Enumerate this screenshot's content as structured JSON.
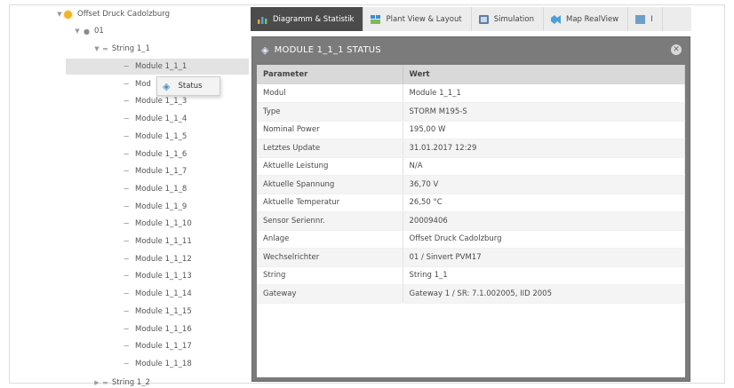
{
  "tree": {
    "root": "Offset Druck Cadolzburg",
    "level1": "01",
    "string_open": "String 1_1",
    "modules": [
      "Module 1_1_1",
      "Mod",
      "Module 1_1_3",
      "Module 1_1_4",
      "Module 1_1_5",
      "Module 1_1_6",
      "Module 1_1_7",
      "Module 1_1_8",
      "Module 1_1_9",
      "Module 1_1_10",
      "Module 1_1_11",
      "Module 1_1_12",
      "Module 1_1_13",
      "Module 1_1_14",
      "Module 1_1_15",
      "Module 1_1_16",
      "Module 1_1_17",
      "Module 1_1_18"
    ],
    "string_closed": "String 1_2"
  },
  "context_menu": {
    "label": "Status"
  },
  "tabs": [
    {
      "label": "Diagramm & Statistik",
      "icon": "bar-chart-icon",
      "active": true
    },
    {
      "label": "Plant View & Layout",
      "icon": "plant-layout-icon",
      "active": false
    },
    {
      "label": "Simulation",
      "icon": "simulation-icon",
      "active": false
    },
    {
      "label": "Map RealView",
      "icon": "map-icon",
      "active": false
    },
    {
      "label": "I",
      "icon": "more-icon",
      "active": false
    }
  ],
  "dialog": {
    "title": "MODULE 1_1_1 STATUS",
    "close_icon": "close-icon",
    "columns": [
      "Parameter",
      "Wert"
    ],
    "rows": [
      [
        "Modul",
        "Module 1_1_1"
      ],
      [
        "Type",
        "STORM M195-S"
      ],
      [
        "Nominal Power",
        "195,00 W"
      ],
      [
        "Letztes Update",
        "31.01.2017 12:29"
      ],
      [
        "Aktuelle Leistung",
        "N/A"
      ],
      [
        "Aktuelle Spannung",
        "36,70 V"
      ],
      [
        "Aktuelle Temperatur",
        "26,50 °C"
      ],
      [
        "Sensor Seriennr.",
        "20009406"
      ],
      [
        "Anlage",
        "Offset Druck Cadolzburg"
      ],
      [
        "Wechselrichter",
        "01 / Sinvert PVM17"
      ],
      [
        "String",
        "String 1_1"
      ],
      [
        "Gateway",
        "Gateway 1 / SR: 7.1.002005, IID 2005"
      ]
    ]
  },
  "colors": {
    "active_tab": "#4b4b4b",
    "dialog_frame": "#7b7b7b",
    "root_status": "#f0b429"
  }
}
